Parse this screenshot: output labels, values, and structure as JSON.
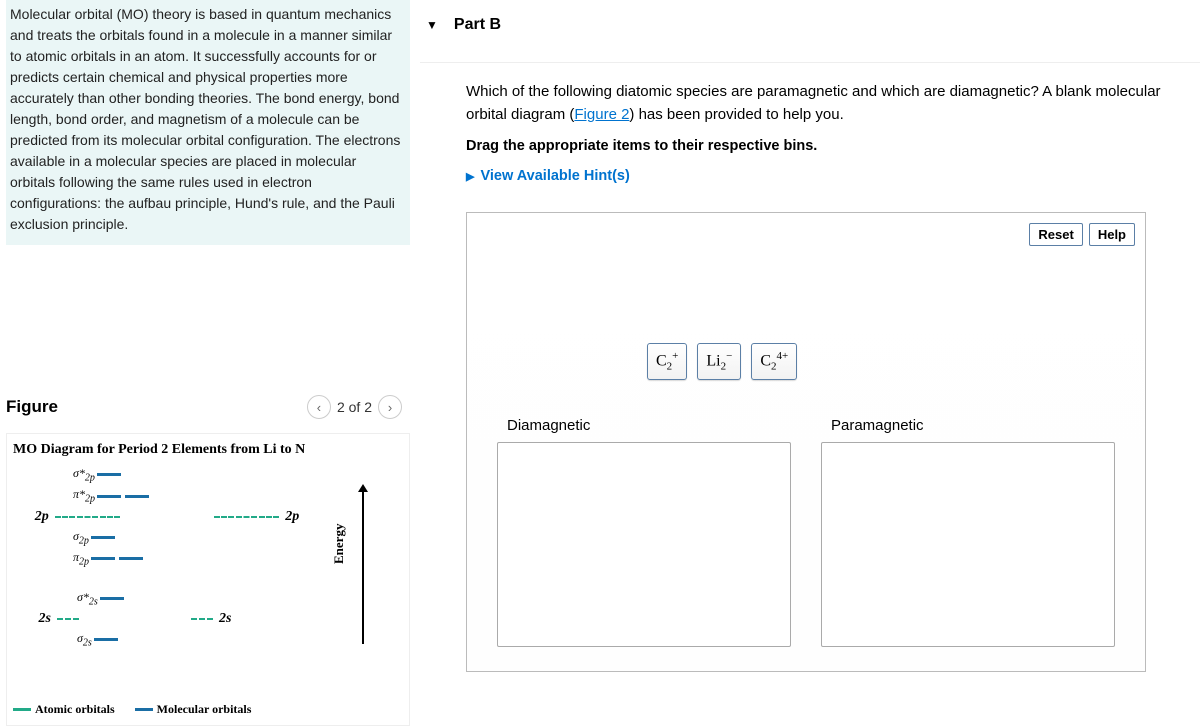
{
  "intro": "Molecular orbital (MO) theory is based in quantum mechanics and treats the orbitals found in a molecule in a manner similar to atomic orbitals in an atom. It successfully accounts for or predicts certain chemical and physical properties more accurately than other bonding theories. The bond energy, bond length, bond order, and magnetism of a molecule can be predicted from its molecular orbital configuration. The electrons available in a molecular species are placed in molecular orbitals following the same rules used in electron configurations: the aufbau principle, Hund's rule, and the Pauli exclusion principle.",
  "figure": {
    "heading": "Figure",
    "pager": "2 of 2",
    "title": "MO Diagram for Period 2 Elements from Li to N",
    "energy_label": "Energy",
    "legend_atomic": "Atomic orbitals",
    "legend_molecular": "Molecular orbitals",
    "labels": {
      "sigma_star_2p": "σ*",
      "pi_star_2p": "π*",
      "sigma_2p": "σ",
      "pi_2p": "π",
      "sigma_star_2s": "σ*",
      "sigma_2s": "σ",
      "ao_2p": "2p",
      "ao_2s": "2s",
      "sub_2p": "2p",
      "sub_2s": "2s"
    }
  },
  "partB": {
    "title": "Part B",
    "question_a": "Which of the following diatomic species are paramagnetic and which are diamagnetic? A blank molecular orbital diagram (",
    "figure_link": "Figure 2",
    "question_b": ") has been provided to help you.",
    "drag_instruction": "Drag the appropriate items to their respective bins.",
    "hints": "View Available Hint(s)",
    "toolbar": {
      "reset": "Reset",
      "help": "Help"
    },
    "chips": {
      "c2plus": "C₂⁺",
      "li2minus": "Li₂⁻",
      "c24plus": "C₂⁴⁺"
    },
    "bins": {
      "dia": "Diamagnetic",
      "para": "Paramagnetic"
    }
  }
}
